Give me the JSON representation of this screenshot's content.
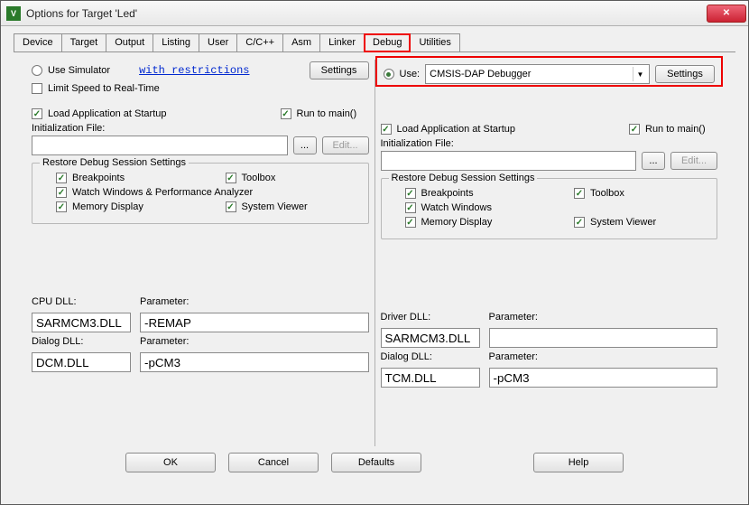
{
  "title": "Options for Target 'Led'",
  "tabs": [
    "Device",
    "Target",
    "Output",
    "Listing",
    "User",
    "C/C++",
    "Asm",
    "Linker",
    "Debug",
    "Utilities"
  ],
  "left": {
    "use_simulator": "Use Simulator",
    "restrictions": "with restrictions",
    "settings": "Settings",
    "limit_speed": "Limit Speed to Real-Time",
    "load_app": "Load Application at Startup",
    "run_main": "Run to main()",
    "init_file": "Initialization File:",
    "browse": "...",
    "edit": "Edit...",
    "restore_group": "Restore Debug Session Settings",
    "breakpoints": "Breakpoints",
    "toolbox": "Toolbox",
    "watch": "Watch Windows & Performance Analyzer",
    "memory": "Memory Display",
    "sysview": "System Viewer",
    "cpu_dll": "CPU DLL:",
    "cpu_dll_val": "SARMCM3.DLL",
    "param1": "Parameter:",
    "param1_val": "-REMAP",
    "dialog_dll": "Dialog DLL:",
    "dialog_dll_val": "DCM.DLL",
    "param2": "Parameter:",
    "param2_val": "-pCM3"
  },
  "right": {
    "use": "Use:",
    "debugger": "CMSIS-DAP Debugger",
    "settings": "Settings",
    "load_app": "Load Application at Startup",
    "run_main": "Run to main()",
    "init_file": "Initialization File:",
    "browse": "...",
    "edit": "Edit...",
    "restore_group": "Restore Debug Session Settings",
    "breakpoints": "Breakpoints",
    "toolbox": "Toolbox",
    "watch": "Watch Windows",
    "memory": "Memory Display",
    "sysview": "System Viewer",
    "driver_dll": "Driver DLL:",
    "driver_dll_val": "SARMCM3.DLL",
    "param1": "Parameter:",
    "param1_val": "",
    "dialog_dll": "Dialog DLL:",
    "dialog_dll_val": "TCM.DLL",
    "param2": "Parameter:",
    "param2_val": "-pCM3"
  },
  "footer": {
    "ok": "OK",
    "cancel": "Cancel",
    "defaults": "Defaults",
    "help": "Help"
  }
}
